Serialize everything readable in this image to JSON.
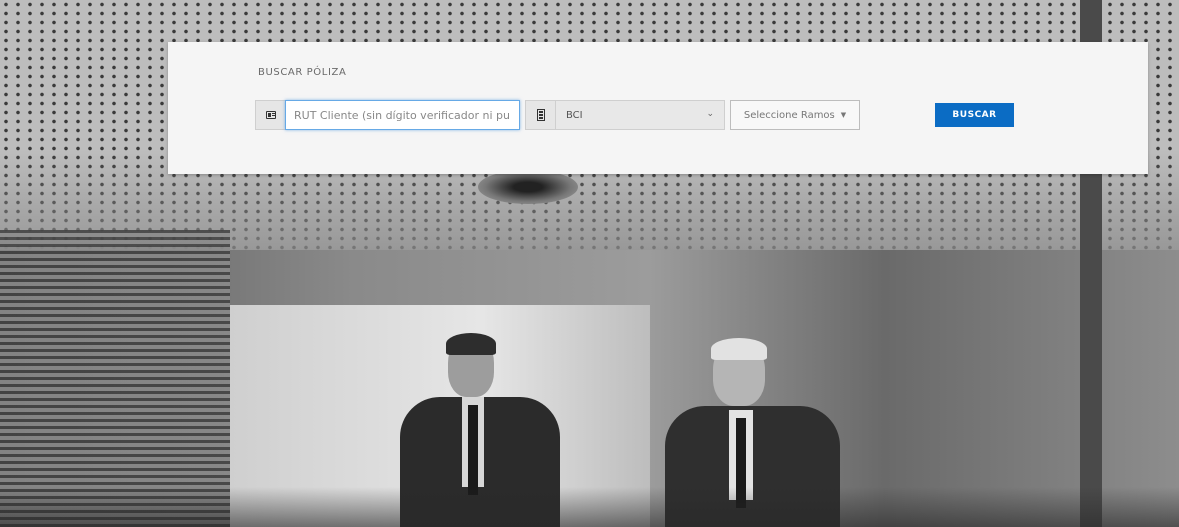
{
  "search_panel": {
    "title": "BUSCAR PÓLIZA",
    "rut_input": {
      "placeholder": "RUT Cliente (sin dígito verificador ni pur",
      "value": "",
      "icon": "id-card-icon"
    },
    "bank_select": {
      "selected": "BCI",
      "icon": "bank-building-icon"
    },
    "ramos_dropdown": {
      "label": "Seleccione Ramos"
    },
    "search_button": {
      "label": "BUSCAR"
    }
  },
  "colors": {
    "accent": "#0b6cc4",
    "panel_bg": "#f5f5f5",
    "focus_border": "#66a9e6"
  }
}
